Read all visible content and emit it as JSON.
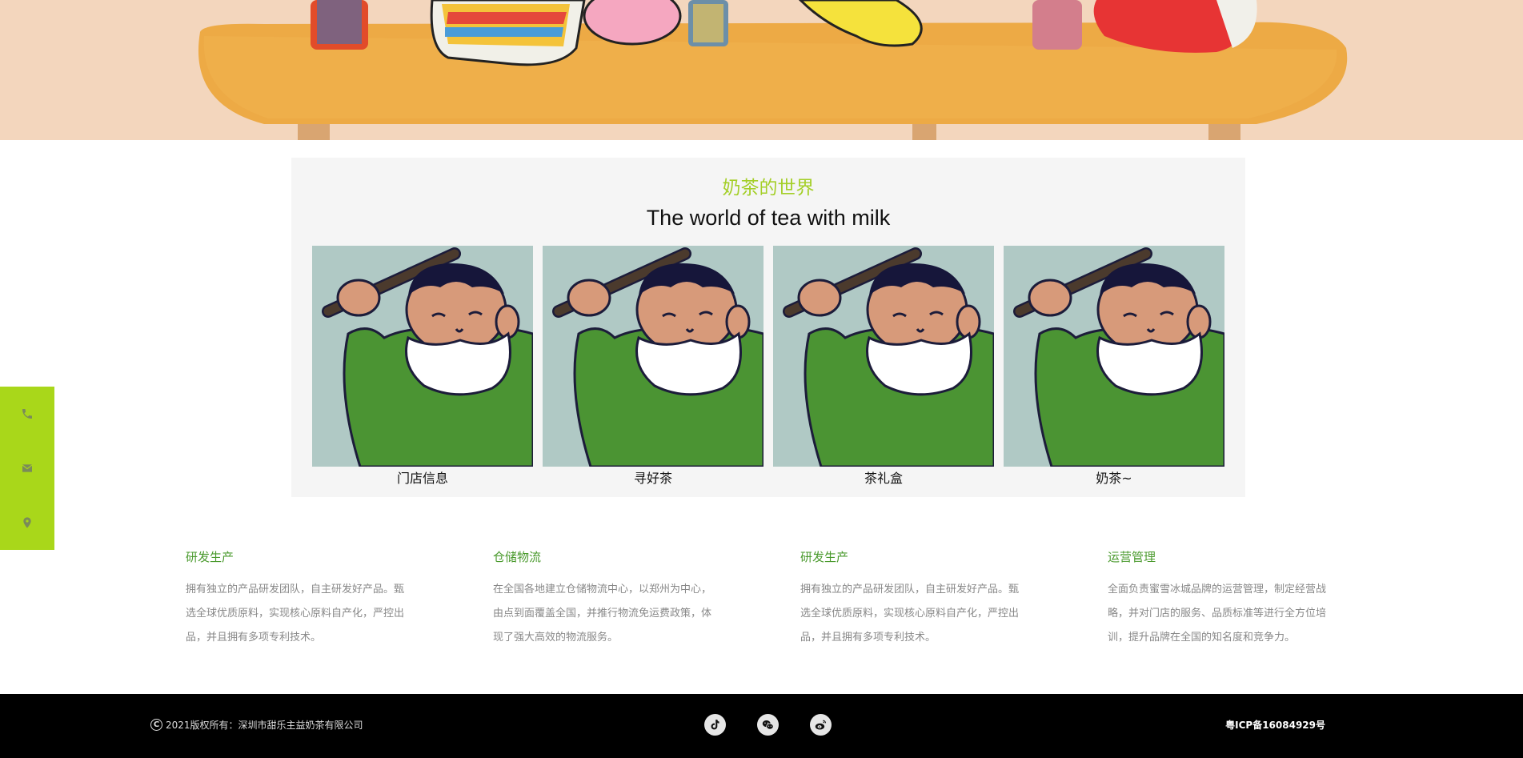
{
  "hero": {
    "image": "armchair-with-toys-banner"
  },
  "world": {
    "title": "奶茶的世界",
    "subtitle": "The world of tea with milk",
    "cards": [
      {
        "label": "门店信息",
        "image": "cartoon-man-with-stick"
      },
      {
        "label": "寻好茶",
        "image": "cartoon-man-with-stick"
      },
      {
        "label": "茶礼盒",
        "image": "cartoon-man-with-stick"
      },
      {
        "label": "奶茶~",
        "image": "cartoon-man-with-stick"
      }
    ]
  },
  "sidebar": {
    "items": [
      {
        "icon": "phone-icon"
      },
      {
        "icon": "mail-icon"
      },
      {
        "icon": "location-pin-icon"
      }
    ],
    "color": "#a9d71a"
  },
  "features": [
    {
      "title": "研发生产",
      "lines": [
        "拥有独立的产品研发团队，自主研发好产品。甄",
        "选全球优质原料，实现核心原料自产化，严控出",
        "品，并且拥有多项专利技术。"
      ]
    },
    {
      "title": "仓储物流",
      "lines": [
        "在全国各地建立仓储物流中心，以郑州为中心，",
        "由点到面覆盖全国，并推行物流免运费政策，体",
        "现了强大高效的物流服务。"
      ]
    },
    {
      "title": "研发生产",
      "lines": [
        "拥有独立的产品研发团队，自主研发好产品。甄",
        "选全球优质原料，实现核心原料自产化，严控出",
        "品，并且拥有多项专利技术。"
      ]
    },
    {
      "title": "运营管理",
      "lines": [
        "全面负责蜜雪冰城品牌的运营管理，制定经营战",
        "略，并对门店的服务、品质标准等进行全方位培",
        "训，提升品牌在全国的知名度和竞争力。"
      ]
    }
  ],
  "footer": {
    "copyright_symbol": "C",
    "copyright": "2021版权所有：深圳市甜乐主益奶茶有限公司",
    "social": [
      "tiktok-icon",
      "wechat-icon",
      "weibo-icon"
    ],
    "icp": "粤ICP备16084929号"
  },
  "colors": {
    "accent": "#a4cf28",
    "feature_title": "#4a9a2d",
    "footer_bg": "#000000"
  }
}
